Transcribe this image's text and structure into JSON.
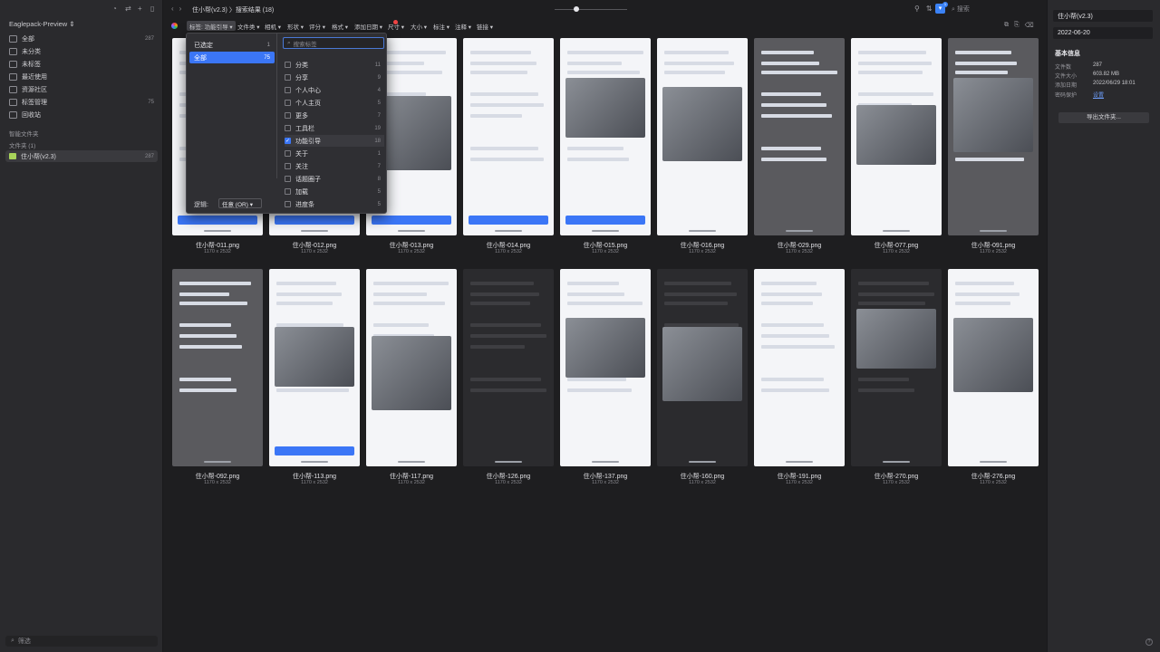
{
  "sidebar": {
    "library_name": "Eaglepack-Preview ⇕",
    "items": [
      {
        "label": "全部",
        "count": "287"
      },
      {
        "label": "未分类",
        "count": ""
      },
      {
        "label": "未标签",
        "count": ""
      },
      {
        "label": "最近使用",
        "count": ""
      },
      {
        "label": "资源社区",
        "count": ""
      },
      {
        "label": "标签管理",
        "count": "75"
      },
      {
        "label": "回收站",
        "count": ""
      }
    ],
    "smart_folders_label": "智能文件夹",
    "folders_label": "文件夹 (1)",
    "folder": {
      "name": "住小帮(v2.3)",
      "count": "287"
    },
    "filter_placeholder": "筛选"
  },
  "toolbar": {
    "breadcrumb": "住小帮(v2.3) 〉搜索结果 (18)",
    "filter_count": "1",
    "search_placeholder": "搜索"
  },
  "filterbar": {
    "chips": [
      "标签: 功能引导 ▾",
      "文件类 ▾",
      "相机 ▾",
      "形状 ▾",
      "评分 ▾",
      "格式 ▾",
      "添加日期 ▾",
      "尺寸 ▾",
      "大小 ▾",
      "标注 ▾",
      "注释 ▾",
      "链接 ▾"
    ]
  },
  "dropdown": {
    "left": [
      {
        "label": "已选定",
        "count": "1"
      },
      {
        "label": "全部",
        "count": "75"
      }
    ],
    "search_placeholder": "搜索标签",
    "tags": [
      {
        "label": "分类",
        "count": "11"
      },
      {
        "label": "分享",
        "count": "9"
      },
      {
        "label": "个人中心",
        "count": "4"
      },
      {
        "label": "个人主页",
        "count": "5"
      },
      {
        "label": "更多",
        "count": "7"
      },
      {
        "label": "工具栏",
        "count": "19"
      },
      {
        "label": "功能引导",
        "count": "18"
      },
      {
        "label": "关于",
        "count": "1"
      },
      {
        "label": "关注",
        "count": "7"
      },
      {
        "label": "话题圈子",
        "count": "8"
      },
      {
        "label": "加载",
        "count": "5"
      },
      {
        "label": "进度条",
        "count": "5"
      }
    ],
    "logic_label": "逻辑:",
    "logic_value": "任意 (OR) ▾"
  },
  "grid": {
    "dimensions": "1170 x 2532",
    "items": [
      {
        "name": "住小帮-011.png",
        "style": "light"
      },
      {
        "name": "住小帮-012.png",
        "style": "light"
      },
      {
        "name": "住小帮-013.png",
        "style": "light"
      },
      {
        "name": "住小帮-014.png",
        "style": "light"
      },
      {
        "name": "住小帮-015.png",
        "style": "light"
      },
      {
        "name": "住小帮-016.png",
        "style": "light"
      },
      {
        "name": "住小帮-029.png",
        "style": "dim"
      },
      {
        "name": "住小帮-077.png",
        "style": "light"
      },
      {
        "name": "住小帮-091.png",
        "style": "dim"
      },
      {
        "name": "住小帮-092.png",
        "style": "dim"
      },
      {
        "name": "住小帮-113.png",
        "style": "light"
      },
      {
        "name": "住小帮-117.png",
        "style": "light"
      },
      {
        "name": "住小帮-126.png",
        "style": "dark"
      },
      {
        "name": "住小帮-137.png",
        "style": "light"
      },
      {
        "name": "住小帮-160.png",
        "style": "dark"
      },
      {
        "name": "住小帮-191.png",
        "style": "light"
      },
      {
        "name": "住小帮-270.png",
        "style": "dark"
      },
      {
        "name": "住小帮-276.png",
        "style": "light"
      }
    ]
  },
  "inspector": {
    "name": "住小帮(v2.3)",
    "date": "2022-06-20",
    "heading": "基本信息",
    "rows": [
      {
        "key": "文件数",
        "value": "287"
      },
      {
        "key": "文件大小",
        "value": "603.82 MB"
      },
      {
        "key": "添加日期",
        "value": "2022/06/29 18:01"
      },
      {
        "key": "密码保护",
        "value": "设置"
      }
    ],
    "export_button": "导出文件夹..."
  },
  "colors": {
    "accent": "#3b76f6",
    "bg": "#1e1e20",
    "panel": "#2a2a2d"
  }
}
